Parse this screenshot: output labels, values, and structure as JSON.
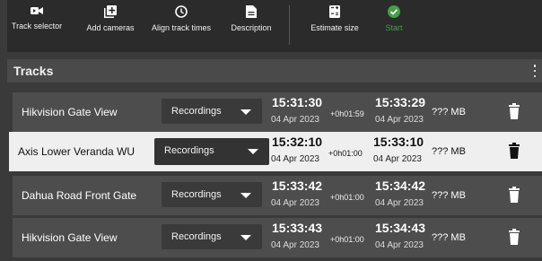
{
  "toolbar": {
    "items": [
      {
        "label": "Track selector",
        "icon": "video-camera-icon"
      },
      {
        "label": "Add cameras",
        "icon": "add-library-icon"
      },
      {
        "label": "Align track times",
        "icon": "clock-icon"
      },
      {
        "label": "Description",
        "icon": "document-icon"
      },
      {
        "label": "Estimate size",
        "icon": "calculator-icon"
      },
      {
        "label": "Start",
        "icon": "check-circle-icon"
      }
    ],
    "start_color": "#43a047"
  },
  "tracks": {
    "title": "Tracks",
    "rows": [
      {
        "camera": "Hikvision Gate View",
        "source": "Recordings",
        "start_time": "15:31:30",
        "start_date": "04 Apr 2023",
        "duration": "+0h01:59",
        "end_time": "15:33:29",
        "end_date": "04 Apr 2023",
        "size": "??? MB",
        "selected": false
      },
      {
        "camera": "Axis Lower Veranda WU",
        "source": "Recordings",
        "start_time": "15:32:10",
        "start_date": "04 Apr 2023",
        "duration": "+0h01:00",
        "end_time": "15:33:10",
        "end_date": "04 Apr 2023",
        "size": "??? MB",
        "selected": true
      },
      {
        "camera": "Dahua Road Front Gate",
        "source": "Recordings",
        "start_time": "15:33:42",
        "start_date": "04 Apr 2023",
        "duration": "+0h01:00",
        "end_time": "15:34:42",
        "end_date": "04 Apr 2023",
        "size": "??? MB",
        "selected": false
      },
      {
        "camera": "Hikvision Gate View",
        "source": "Recordings",
        "start_time": "15:33:43",
        "start_date": "04 Apr 2023",
        "duration": "+0h01:00",
        "end_time": "15:34:43",
        "end_date": "04 Apr 2023",
        "size": "??? MB",
        "selected": false
      }
    ]
  }
}
